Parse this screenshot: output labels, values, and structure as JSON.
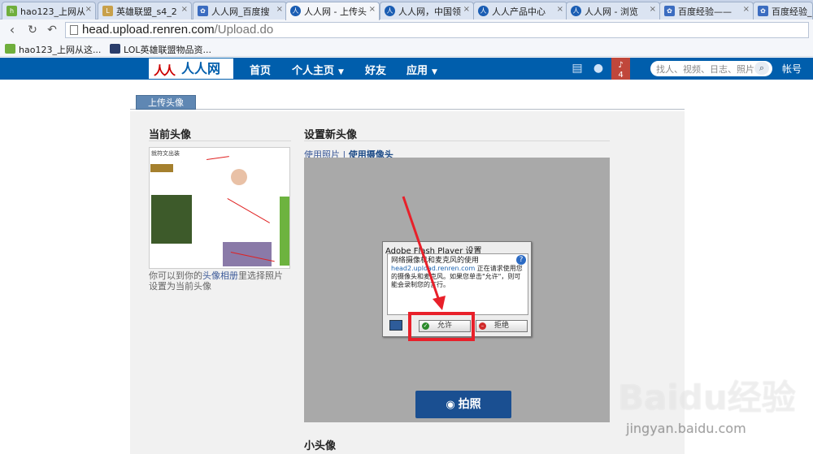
{
  "browser": {
    "tabs": [
      {
        "label": "hao123_上网从",
        "icon": "hao123-icon",
        "active": false
      },
      {
        "label": "英雄联盟_s4_2",
        "icon": "lol-icon",
        "active": false
      },
      {
        "label": "人人网_百度搜",
        "icon": "baidu-paw-icon",
        "active": false
      },
      {
        "label": "人人网 - 上传头",
        "icon": "renren-icon",
        "active": true
      },
      {
        "label": "人人网，中国领",
        "icon": "renren-icon",
        "active": false
      },
      {
        "label": "人人产品中心",
        "icon": "renren-icon",
        "active": false
      },
      {
        "label": "人人网 - 浏览",
        "icon": "renren-icon",
        "active": false
      },
      {
        "label": "百度经验——",
        "icon": "baidu-paw-icon",
        "active": false
      },
      {
        "label": "百度经验_个",
        "icon": "baidu-paw-icon",
        "active": false
      }
    ],
    "url": {
      "host": "head.upload.renren.com",
      "path": "/Upload.do"
    },
    "bookmarks": [
      {
        "label": "hao123_上网从这..."
      },
      {
        "label": "LOL英雄联盟物品资..."
      }
    ]
  },
  "site": {
    "logo_text": "人人网",
    "nav": [
      {
        "label": "首页",
        "caret": false
      },
      {
        "label": "个人主页",
        "caret": true
      },
      {
        "label": "好友",
        "caret": false
      },
      {
        "label": "应用",
        "caret": true
      }
    ],
    "notification_count": "4",
    "search_placeholder": "找人、视频、日志、照片",
    "account_label": "帐号"
  },
  "page": {
    "tab_label": "上传头像",
    "current_avatar": {
      "heading": "当前头像",
      "thumb_title": "就符文出装",
      "desc_prefix": "你可以到你的",
      "desc_link": "头像相册",
      "desc_suffix": "里选择照片设置为当前头像"
    },
    "new_avatar": {
      "heading": "设置新头像",
      "link_photo": "使用照片",
      "separator": "|",
      "link_camera": "使用摄像头"
    },
    "small_avatar_heading": "小头像",
    "shoot_button": "拍照"
  },
  "flash_dialog": {
    "title": "Adobe Flash Player 设置",
    "heading": "网络摄像机和麦克风的使用",
    "domain": "head2.upload.renren.com",
    "body": "正在请求使用您的摄像头和麦克风。如果您单击\"允许\"，则可能会录制您的言行。",
    "allow": "允许",
    "deny": "拒绝"
  },
  "watermark": {
    "brand": "Baidu经验",
    "site": "jingyan.baidu.com"
  },
  "colors": {
    "renren_blue": "#005eac",
    "highlight_red": "#e8202a",
    "button_blue": "#1a4f91"
  }
}
